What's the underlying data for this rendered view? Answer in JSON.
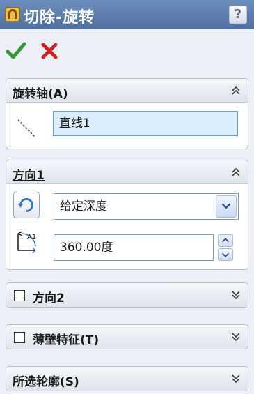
{
  "window": {
    "title": "切除-旋转",
    "help_label": "?"
  },
  "confirm": {
    "ok_icon": "green-checkmark-icon",
    "cancel_icon": "red-x-icon",
    "ok_color": "#3aa23a",
    "cancel_color": "#d42020"
  },
  "groups": {
    "axis": {
      "title": "旋转轴(A)",
      "value": "直线1",
      "expanded": true
    },
    "direction1": {
      "title": "方向1",
      "end_condition": "给定深度",
      "angle": "360.00度",
      "expanded": true
    },
    "direction2": {
      "title": "方向2",
      "checked": false,
      "expanded": false
    },
    "thin_feature": {
      "title": "薄壁特征(T)",
      "checked": false,
      "expanded": false
    },
    "selected_contours": {
      "title": "所选轮廓(S)",
      "expanded": false
    }
  }
}
